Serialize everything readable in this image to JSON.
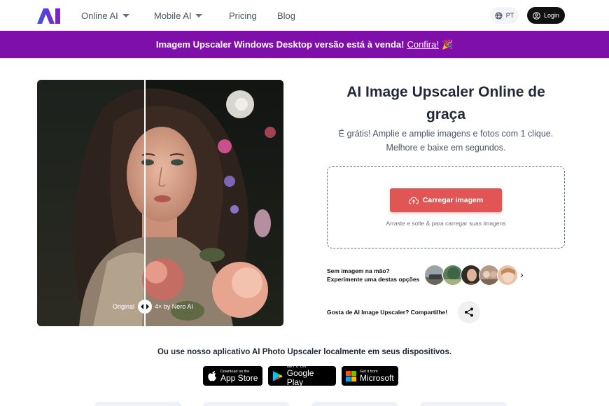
{
  "header": {
    "logo_text": "AI",
    "nav": [
      {
        "label": "Online AI",
        "has_dropdown": true
      },
      {
        "label": "Mobile AI",
        "has_dropdown": true
      },
      {
        "label": "Pricing",
        "has_dropdown": false
      },
      {
        "label": "Blog",
        "has_dropdown": false
      }
    ],
    "lang_label": "PT",
    "login_label": "Login"
  },
  "banner": {
    "text": "Imagem Upscaler Windows Desktop versão está à venda!",
    "link": "Confira!",
    "emoji": "🎉"
  },
  "compare": {
    "left_caption": "Original",
    "right_caption": "4× by Nero AI"
  },
  "hero": {
    "title": "AI Image Upscaler Online de graça",
    "subtitle": "É grátis! Amplie e amplie imagens e fotos com 1 clique. Melhore e baixe em segundos.",
    "upload_label": "Carregar imagem",
    "drop_hint": "Arraste e solte & para carregar suas imagens"
  },
  "samples": {
    "line1": "Sem imagem na mão?",
    "line2": "Experimente uma destas opções"
  },
  "share": {
    "text": "Gosta de AI Image Upscaler? Compartilhe!"
  },
  "apps": {
    "text": "Ou use nosso aplicativo AI Photo Upscaler localmente em seus dispositivos.",
    "stores": [
      {
        "small": "Download on the",
        "big": "App Store"
      },
      {
        "small": "GET IT ON",
        "big": "Google Play"
      },
      {
        "small": "Get it from",
        "big": "Microsoft"
      }
    ]
  },
  "colors": {
    "banner": "#7e0fa8",
    "upload_button": "#e25555",
    "logo_gradient_start": "#3b5bdb",
    "logo_gradient_end": "#7e22ce"
  }
}
